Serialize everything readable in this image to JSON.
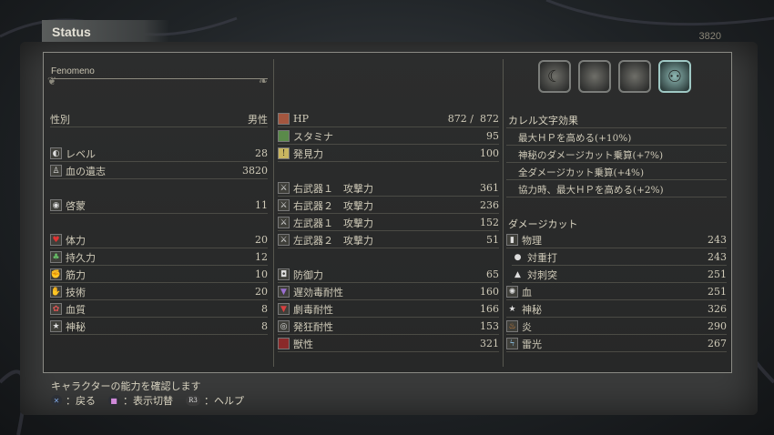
{
  "header": {
    "tab_label": "Status",
    "souls_top": "3820"
  },
  "character": {
    "name": "Fenomeno"
  },
  "col1": {
    "gender": {
      "label": "性別",
      "value": "男性"
    },
    "level": [
      {
        "icon": "level-icon",
        "glyph": "◐",
        "label": "レベル",
        "value": "28"
      },
      {
        "icon": "blood-echoes-icon",
        "glyph": "♙",
        "label": "血の遺志",
        "value": "3820"
      }
    ],
    "insight": {
      "icon": "insight-eye-icon",
      "glyph": "◉",
      "label": "啓蒙",
      "value": "11"
    },
    "stats": [
      {
        "icon": "vitality-icon",
        "glyph": "♥",
        "label": "体力",
        "value": "20"
      },
      {
        "icon": "endurance-icon",
        "glyph": "♣",
        "label": "持久力",
        "value": "12"
      },
      {
        "icon": "strength-icon",
        "glyph": "✊",
        "label": "筋力",
        "value": "10"
      },
      {
        "icon": "skill-icon",
        "glyph": "✋",
        "label": "技術",
        "value": "20"
      },
      {
        "icon": "bloodtinge-icon",
        "glyph": "✿",
        "label": "血質",
        "value": "8"
      },
      {
        "icon": "arcane-icon",
        "glyph": "★",
        "label": "神秘",
        "value": "8"
      }
    ]
  },
  "col2": {
    "hp": {
      "icon": "hp-icon",
      "glyph": "▪",
      "label": "HP",
      "current": "872",
      "sep": "/",
      "max": "872"
    },
    "misc": [
      {
        "icon": "stamina-icon",
        "glyph": "▪",
        "label": "スタミナ",
        "value": "95"
      },
      {
        "icon": "discovery-icon",
        "glyph": "!",
        "label": "発見力",
        "value": "100"
      }
    ],
    "weapons": [
      {
        "icon": "right-weapon-1-icon",
        "glyph": "⚔",
        "label": "右武器１　攻撃力",
        "value": "361"
      },
      {
        "icon": "right-weapon-2-icon",
        "glyph": "⚔",
        "label": "右武器２　攻撃力",
        "value": "236"
      },
      {
        "icon": "left-weapon-1-icon",
        "glyph": "⚔",
        "label": "左武器１　攻撃力",
        "value": "152"
      },
      {
        "icon": "left-weapon-2-icon",
        "glyph": "⚔",
        "label": "左武器２　攻撃力",
        "value": "51"
      }
    ],
    "defense": [
      {
        "icon": "defense-icon",
        "glyph": "◘",
        "label": "防御力",
        "value": "65"
      },
      {
        "icon": "slow-poison-icon",
        "glyph": "▼",
        "label": "遅効毒耐性",
        "value": "160"
      },
      {
        "icon": "rapid-poison-icon",
        "glyph": "▼",
        "label": "劇毒耐性",
        "value": "166"
      },
      {
        "icon": "frenzy-icon",
        "glyph": "◎",
        "label": "発狂耐性",
        "value": "153"
      },
      {
        "icon": "beasthood-icon",
        "glyph": "▩",
        "label": "獣性",
        "value": "321"
      }
    ]
  },
  "col3": {
    "runes": [
      {
        "icon": "rune-moon-icon",
        "glyph": "☾"
      },
      {
        "icon": "rune-blank-icon",
        "glyph": ""
      },
      {
        "icon": "rune-blank-2-icon",
        "glyph": ""
      },
      {
        "icon": "rune-active-icon",
        "glyph": "⚇"
      }
    ],
    "caryll_title": "カレル文字効果",
    "effects": [
      "最大ＨＰを高める(+10%)",
      "神秘のダメージカット乗算(+7%)",
      "全ダメージカット乗算(+4%)",
      "協力時、最大ＨＰを高める(+2%)"
    ],
    "damage_title": "ダメージカット",
    "damage": [
      {
        "icon": "physical-icon",
        "glyph": "▮",
        "label": "物理",
        "value": "243",
        "indent": false
      },
      {
        "icon": "blunt-icon",
        "glyph": "●",
        "label": "対重打",
        "value": "243",
        "indent": true
      },
      {
        "icon": "thrust-icon",
        "glyph": "▲",
        "label": "対刺突",
        "value": "251",
        "indent": true
      },
      {
        "icon": "blood-icon",
        "glyph": "✺",
        "label": "血",
        "value": "251",
        "indent": false
      },
      {
        "icon": "arcane-damage-icon",
        "glyph": "★",
        "label": "神秘",
        "value": "326",
        "indent": false
      },
      {
        "icon": "fire-icon",
        "glyph": "♨",
        "label": "炎",
        "value": "290",
        "indent": false
      },
      {
        "icon": "bolt-icon",
        "glyph": "ϟ",
        "label": "雷光",
        "value": "267",
        "indent": false
      }
    ]
  },
  "footer": {
    "hint": "キャラクターの能力を確認します",
    "back": "：戻る",
    "toggle": "：表示切替",
    "help": "：ヘルプ",
    "r3": "R3"
  }
}
